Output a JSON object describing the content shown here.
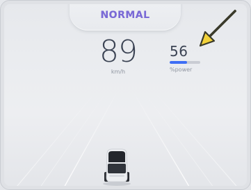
{
  "drive_mode": {
    "label": "NORMAL"
  },
  "speed": {
    "value": "89",
    "unit": "km/h"
  },
  "power": {
    "value": "56",
    "unit": "%power",
    "fraction": 0.56
  },
  "colors": {
    "accent": "#7a6ad6",
    "power_bar": "#3d6ef5",
    "arrow": "#f2d23a"
  },
  "icons": {
    "pointer": "arrow-icon",
    "vehicle": "car-icon"
  }
}
